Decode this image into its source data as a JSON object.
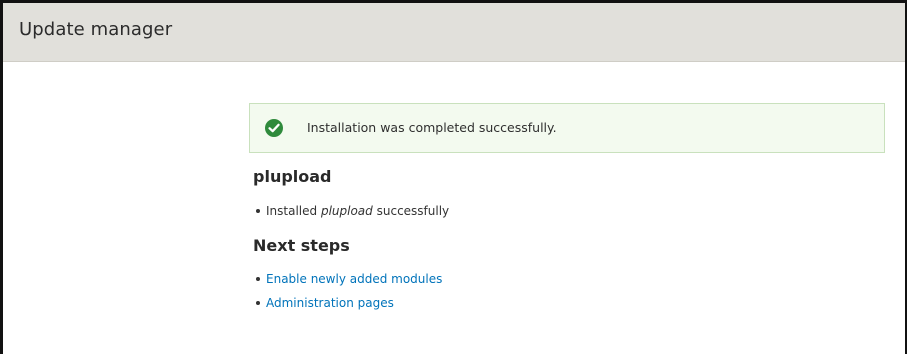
{
  "page": {
    "title": "Update manager"
  },
  "status": {
    "message": "Installation was completed successfully.",
    "icon": "check-circle-icon",
    "color": "#2f8a3c"
  },
  "project": {
    "name": "plupload",
    "result_prefix": "Installed",
    "result_project": "plupload",
    "result_suffix": "successfully"
  },
  "next_steps": {
    "title": "Next steps",
    "links": [
      "Enable newly added modules",
      "Administration pages"
    ]
  }
}
